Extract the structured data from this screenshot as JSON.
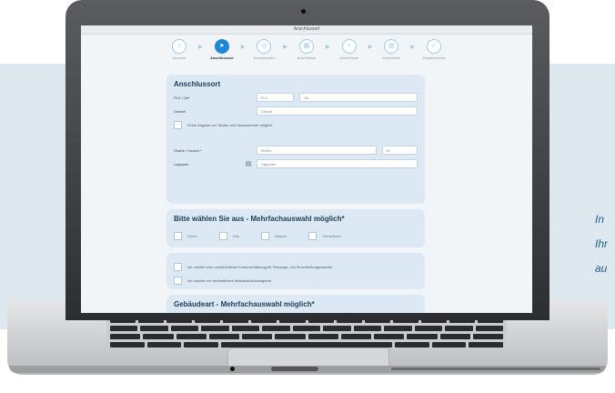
{
  "side_text": [
    "In",
    "Ihr",
    "au"
  ],
  "window": {
    "title": "Anschlussort"
  },
  "stepper": [
    {
      "icon": "person-icon",
      "glyph": "☺",
      "label": "Account",
      "active": false
    },
    {
      "icon": "location-arrow-icon",
      "glyph": "➤",
      "label": "Anschlussort",
      "active": true
    },
    {
      "icon": "location-pin-icon",
      "glyph": "◎",
      "label": "Anschlussart",
      "active": false
    },
    {
      "icon": "grid-icon",
      "glyph": "▦",
      "label": "Anschlüsse",
      "active": false
    },
    {
      "icon": "search-icon",
      "glyph": "⌕",
      "label": "Anschlüsse",
      "active": false
    },
    {
      "icon": "document-icon",
      "glyph": "▤",
      "label": "Dokumente",
      "active": false
    },
    {
      "icon": "check-icon",
      "glyph": "✓",
      "label": "Zusammenfas",
      "active": false
    }
  ],
  "form": {
    "title": "Anschlussort",
    "plz_label": "PLZ / Ort*",
    "plz_placeholder": "PLZ",
    "ort_placeholder": "Ort",
    "ortsteil_label": "Ortsteil",
    "ortsteil_placeholder": "Ortsteil",
    "no_street_label": "Keine Angabe von Straße und Hausnummer möglich",
    "street_label": "Straße / Hausnr.*",
    "street_placeholder": "Straße",
    "nr_placeholder": "Nr.",
    "lage_label": "Lageplan",
    "lage_placeholder": "Lageplan"
  },
  "choice": {
    "title": "Bitte wählen Sie aus - Mehrfachauswahl möglich*",
    "options": [
      "Strom",
      "Gas",
      "Wasser",
      "Fernwärme"
    ]
  },
  "info": {
    "check1": "Ich möchte eine unverbindliche Kostenschätzung für Planungs- und Erschließungszwecke",
    "check2": "Ich möchte ein verbindliches Netzanschlussangebot"
  },
  "building": {
    "title": "Gebäudeart - Mehrfachauswahl möglich*"
  }
}
